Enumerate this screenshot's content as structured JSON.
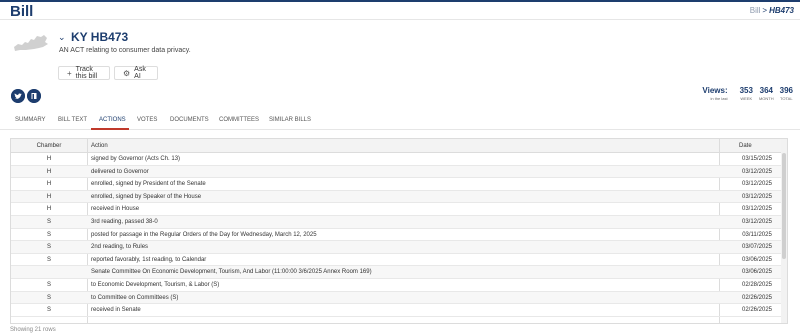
{
  "page_title": "Bill",
  "breadcrumb": {
    "parent": "Bill",
    "separator": ">",
    "current": "HB473"
  },
  "bill": {
    "id": "KY HB473",
    "description": "AN ACT relating to consumer data privacy."
  },
  "buttons": {
    "track": "Track this bill",
    "ask": "Ask AI"
  },
  "views": {
    "label": "Views:",
    "sublabel": "in the last",
    "week": {
      "value": "353",
      "label": "WEEK"
    },
    "month": {
      "value": "364",
      "label": "MONTH"
    },
    "total": {
      "value": "396",
      "label": "TOTAL"
    }
  },
  "tabs": [
    "SUMMARY",
    "BILL TEXT",
    "ACTIONS",
    "VOTES",
    "DOCUMENTS",
    "COMMITTEES",
    "SIMILAR BILLS"
  ],
  "active_tab": "ACTIONS",
  "table": {
    "headers": {
      "chamber": "Chamber",
      "action": "Action",
      "date": "Date"
    },
    "rows": [
      {
        "chamber": "H",
        "action": "signed by Governor (Acts Ch. 13)",
        "date": "03/15/2025"
      },
      {
        "chamber": "H",
        "action": "delivered to Governor",
        "date": "03/12/2025"
      },
      {
        "chamber": "H",
        "action": "enrolled, signed by President of the Senate",
        "date": "03/12/2025"
      },
      {
        "chamber": "H",
        "action": "enrolled, signed by Speaker of the House",
        "date": "03/12/2025"
      },
      {
        "chamber": "H",
        "action": "received in House",
        "date": "03/12/2025"
      },
      {
        "chamber": "S",
        "action": "3rd reading, passed 38-0",
        "date": "03/12/2025"
      },
      {
        "chamber": "S",
        "action": "posted for passage in the Regular Orders of the Day for Wednesday, March 12, 2025",
        "date": "03/11/2025"
      },
      {
        "chamber": "S",
        "action": "2nd reading, to Rules",
        "date": "03/07/2025"
      },
      {
        "chamber": "S",
        "action": "reported favorably, 1st reading, to Calendar",
        "date": "03/06/2025"
      },
      {
        "chamber": "",
        "action": "Senate Committee On Economic Development, Tourism, And Labor (11:00:00 3/6/2025 Annex Room 169)",
        "date": "03/06/2025"
      },
      {
        "chamber": "S",
        "action": "to Economic Development, Tourism, & Labor (S)",
        "date": "02/28/2025"
      },
      {
        "chamber": "S",
        "action": "to Committee on Committees (S)",
        "date": "02/26/2025"
      },
      {
        "chamber": "S",
        "action": "received in Senate",
        "date": "02/26/2025"
      }
    ]
  },
  "footer": {
    "count": "Showing 21 rows"
  },
  "colors": {
    "brand": "#1d3d6e",
    "tab_accent": "#c0392b"
  },
  "icons": {
    "track": "plus-icon",
    "ask": "wrench-icon",
    "social1": "twitter-icon",
    "social2": "facebook-icon",
    "sort": "caret-down-icon",
    "collapse": "chevron-down-icon"
  }
}
